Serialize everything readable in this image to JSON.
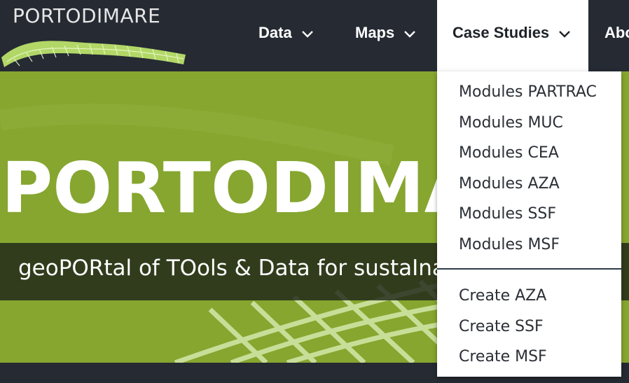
{
  "brand": {
    "logo_text": "PORTODIMARE"
  },
  "nav": {
    "items": [
      {
        "label": "Data"
      },
      {
        "label": "Maps"
      },
      {
        "label": "Case Studies"
      },
      {
        "label": "Abo"
      }
    ]
  },
  "hero": {
    "title": "PORTODIMA",
    "subtitle": "geoPORtal of TOols & Data for sustaIna"
  },
  "dropdown": {
    "items": [
      "Modules PARTRAC",
      "Modules MUC",
      "Modules CEA",
      "Modules AZA",
      "Modules SSF",
      "Modules MSF",
      "Create AZA",
      "Create SSF",
      "Create MSF"
    ]
  },
  "colors": {
    "header_bg": "#252a33",
    "hero_green": "#86a62f",
    "accent_light_green": "#b9e06a"
  }
}
